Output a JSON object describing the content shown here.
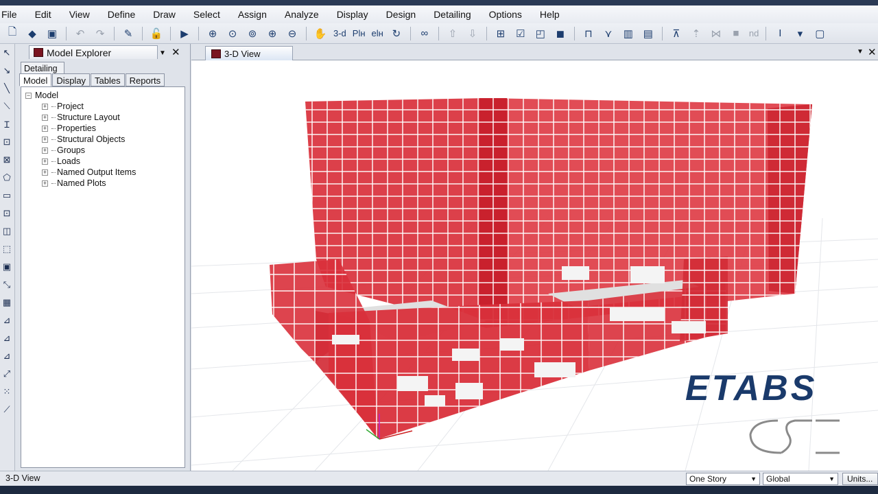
{
  "menu": [
    "File",
    "Edit",
    "View",
    "Define",
    "Draw",
    "Select",
    "Assign",
    "Analyze",
    "Display",
    "Design",
    "Detailing",
    "Options",
    "Help"
  ],
  "toolbar": {
    "view_3d_label": "3-d",
    "plan_label": "Plн",
    "elev_label": "elн",
    "nd_label": "nd",
    "text_tool": "I"
  },
  "explorer": {
    "title": "Model Explorer",
    "detailing_tab": "Detailing",
    "tabs": [
      "Model",
      "Display",
      "Tables",
      "Reports"
    ],
    "tree_root": "Model",
    "tree_items": [
      "Project",
      "Structure Layout",
      "Properties",
      "Structural Objects",
      "Groups",
      "Loads",
      "Named Output Items",
      "Named Plots"
    ]
  },
  "view": {
    "tab_title": "3-D View"
  },
  "logo": {
    "text": "ETABS",
    "color": "#1a3a6b"
  },
  "colors": {
    "model_red": "#d9303b",
    "panel_bg": "#dfe3ea"
  },
  "status": {
    "text": "3-D View",
    "story_select": "One Story",
    "coord_select": "Global",
    "units_button": "Units..."
  }
}
